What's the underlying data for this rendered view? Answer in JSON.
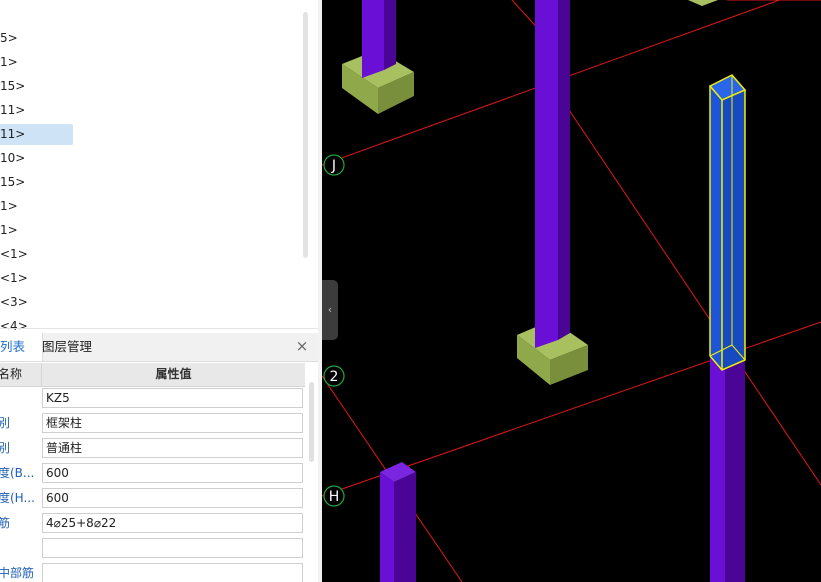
{
  "tree": {
    "items": [
      {
        "label": "5>",
        "selected": false
      },
      {
        "label": "1>",
        "selected": false
      },
      {
        "label": "15>",
        "selected": false
      },
      {
        "label": "11>",
        "selected": false
      },
      {
        "label": "11>",
        "selected": true
      },
      {
        "label": "10>",
        "selected": false
      },
      {
        "label": "15>",
        "selected": false
      },
      {
        "label": "1>",
        "selected": false
      },
      {
        "label": "1>",
        "selected": false
      },
      {
        "label": "<1>",
        "selected": false
      },
      {
        "label": "<1>",
        "selected": false
      },
      {
        "label": "<3>",
        "selected": false
      },
      {
        "label": "<4>",
        "selected": false
      }
    ]
  },
  "tabs": {
    "list_label": "列表",
    "layer_label": "图层管理",
    "close_glyph": "×"
  },
  "properties": {
    "header_name": "名称",
    "header_value": "属性值",
    "rows": [
      {
        "name": "",
        "value": "KZ5"
      },
      {
        "name": "別",
        "value": "框架柱"
      },
      {
        "name": "別",
        "value": "普通柱"
      },
      {
        "name": "度(B...",
        "value": "600"
      },
      {
        "name": "度(H...",
        "value": "600"
      },
      {
        "name": "筋",
        "value": "4⌀25+8⌀22"
      },
      {
        "name": "",
        "value": ""
      },
      {
        "name": "中部筋",
        "value": ""
      }
    ]
  },
  "viewport": {
    "axis_markers": [
      "J",
      "2",
      "H"
    ],
    "collapse_glyph": "‹",
    "colors": {
      "background": "#000000",
      "grid_line": "#e01818",
      "column": "#6a0fd6",
      "column_dark": "#4a0596",
      "footing": "#a0b85a",
      "footing_dark": "#7a8f3c",
      "selection": "#f2f200",
      "selected_face": "#1e55d8",
      "axis_circle": "#1fa83a"
    }
  }
}
